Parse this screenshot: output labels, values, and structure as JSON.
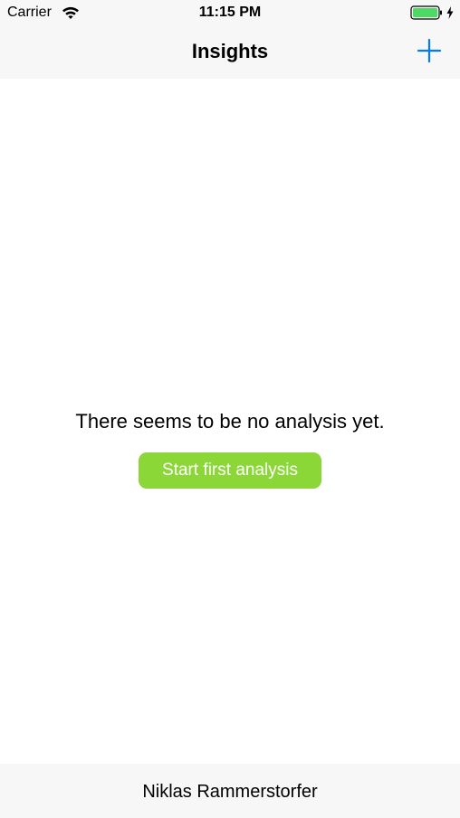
{
  "status_bar": {
    "carrier": "Carrier",
    "time": "11:15 PM",
    "wifi_icon": "wifi-icon",
    "battery_icon": "battery-icon",
    "charging_icon": "charging-bolt-icon",
    "battery_color": "#4cd964"
  },
  "nav": {
    "title": "Insights",
    "add_icon": "plus-icon",
    "tint_color": "#007aff"
  },
  "empty_state": {
    "message": "There seems to be no analysis yet.",
    "button_label": "Start first analysis",
    "button_color": "#8cd738"
  },
  "footer": {
    "text": "Niklas Rammerstorfer"
  }
}
